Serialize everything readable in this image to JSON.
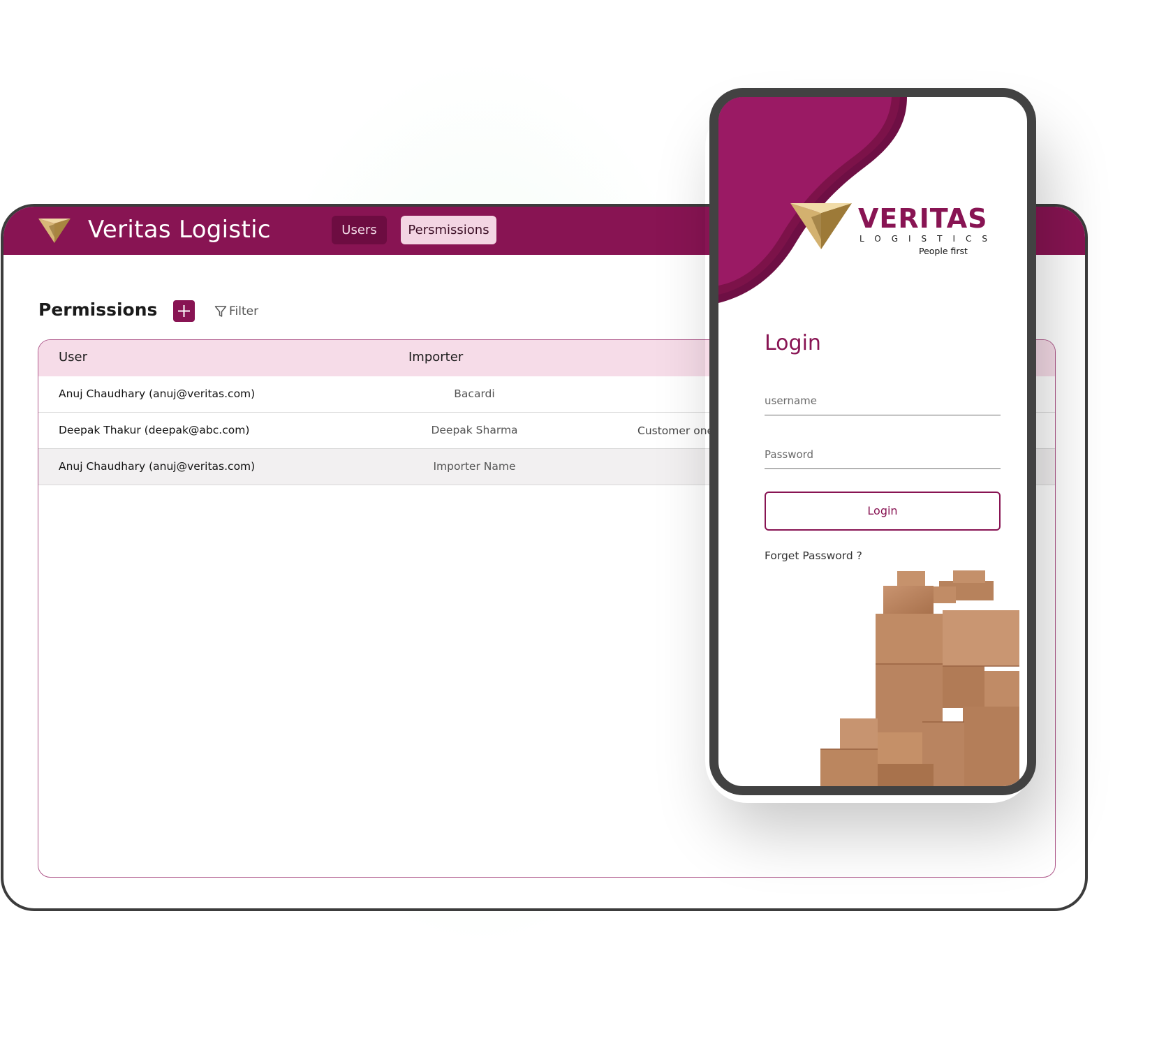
{
  "app": {
    "title": "Veritas Logistic",
    "tabs": [
      {
        "label": "Users",
        "active": false
      },
      {
        "label": "Persmissions",
        "active": true
      }
    ]
  },
  "permissions": {
    "title": "Permissions",
    "filter_label": "Filter",
    "columns": [
      "User",
      "Importer"
    ],
    "rows": [
      {
        "user": "Anuj Chaudhary (anuj@veritas.com)",
        "importer": "Bacardi",
        "customer": ""
      },
      {
        "user": "Deepak Thakur (deepak@abc.com)",
        "importer": "Deepak Sharma",
        "customer": "Customer one,"
      },
      {
        "user": "Anuj Chaudhary (anuj@veritas.com)",
        "importer": "Importer Name",
        "customer": ""
      }
    ]
  },
  "mobile": {
    "brand": {
      "name": "VERITAS",
      "sub": "LOGISTICS",
      "tagline": "People first"
    },
    "login_title": "Login",
    "username_placeholder": "username",
    "password_placeholder": "Password",
    "login_button": "Login",
    "forgot_link": "Forget Password ?"
  },
  "colors": {
    "brand": "#881453",
    "brand_dark": "#6d0c41",
    "header_row": "#f6dce8",
    "gold": "#c9a45a"
  },
  "icons": [
    "veritas-logo-icon",
    "plus-icon",
    "filter-icon",
    "boxes-illustration"
  ]
}
